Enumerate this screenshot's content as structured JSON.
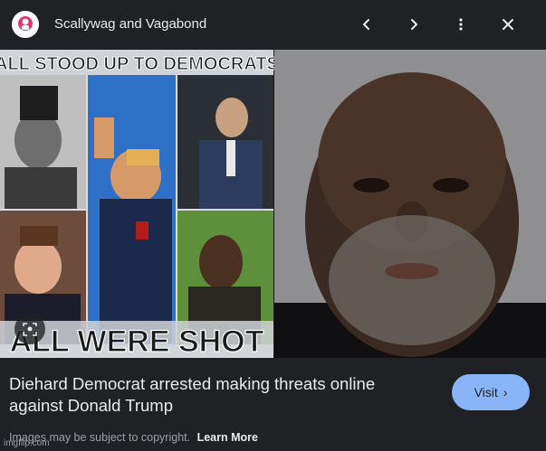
{
  "header": {
    "site_name": "Scallywag and Vagabond",
    "site_icon": "site-avatar-icon",
    "prev_icon": "chevron-left-icon",
    "next_icon": "chevron-right-icon",
    "more_icon": "more-vert-icon",
    "close_icon": "close-icon"
  },
  "preview": {
    "meme_top_text": "ALL STOOD UP TO DEMOCRATS",
    "meme_bottom_text": "ALL WERE SHOT",
    "lens_icon": "lens-search-icon"
  },
  "result": {
    "title_line1": "Diehard Democrat arrested making threats online",
    "title_line2": "against Donald Trump",
    "visit_label": "Visit",
    "copyright_notice": "Images may be subject to copyright.",
    "learn_more_label": "Learn More"
  },
  "watermark": "imgflip.com",
  "colors": {
    "background": "#202124",
    "accent": "#8ab4f8",
    "text": "#e8eaed",
    "muted": "#9aa0a6"
  }
}
